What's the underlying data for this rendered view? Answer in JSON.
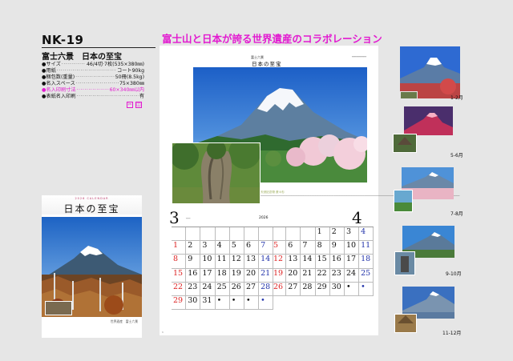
{
  "product": {
    "code": "NK-19",
    "title": "富士六景　日本の至宝",
    "headline": "富士山と日本が誇る世界遺産のコラボレーション"
  },
  "specs": [
    {
      "label": "●サイズ",
      "value": "46/4切·7枚(535×380㎜)",
      "highlight": false
    },
    {
      "label": "●用紙",
      "value": "コート90kg",
      "highlight": false
    },
    {
      "label": "●梱包数(重量)",
      "value": "50冊(8.5kg)",
      "highlight": false
    },
    {
      "label": "●名入スペース",
      "value": "75×380㎜",
      "highlight": false
    },
    {
      "label": "●名入印刷寸法",
      "value": "60×340㎜以内",
      "highlight": true
    },
    {
      "label": "●表紙名入印刷",
      "value": "有",
      "highlight": false
    }
  ],
  "small_calendar": {
    "header": "2026 CALENDAR",
    "title": "日本の至宝",
    "caption": "世界遺産　富士六景"
  },
  "big_calendar": {
    "header_small": "富士六景",
    "title": "日本の至宝",
    "photo_caption": "天然記念物 蒼々杉",
    "year": "2026",
    "month_left": "3",
    "month_right": "4",
    "page_mark": "6",
    "march_days": [
      "",
      "",
      "",
      "",
      "",
      "",
      "",
      "1",
      "2",
      "3",
      "4",
      "5",
      "6",
      "7",
      "8",
      "9",
      "10",
      "11",
      "12",
      "13",
      "14",
      "15",
      "16",
      "17",
      "18",
      "19",
      "20",
      "21",
      "22",
      "23",
      "24",
      "25",
      "26",
      "27",
      "28",
      "29",
      "30",
      "31",
      "•",
      "•",
      "•",
      "•"
    ],
    "april_days": [
      "",
      "",
      "",
      "1",
      "2",
      "3",
      "4",
      "5",
      "6",
      "7",
      "8",
      "9",
      "10",
      "11",
      "12",
      "13",
      "14",
      "15",
      "16",
      "17",
      "18",
      "19",
      "20",
      "21",
      "22",
      "23",
      "24",
      "25",
      "26",
      "27",
      "28",
      "29",
      "30",
      "•",
      "•"
    ]
  },
  "thumbnails": [
    {
      "label": "1-2月"
    },
    {
      "label": "5-6月"
    },
    {
      "label": "7-8月"
    },
    {
      "label": "9-10月"
    },
    {
      "label": "11-12月"
    }
  ],
  "colors": {
    "accent_pink": "#e21ad0",
    "sunday_red": "#d22",
    "saturday_blue": "#23a"
  }
}
